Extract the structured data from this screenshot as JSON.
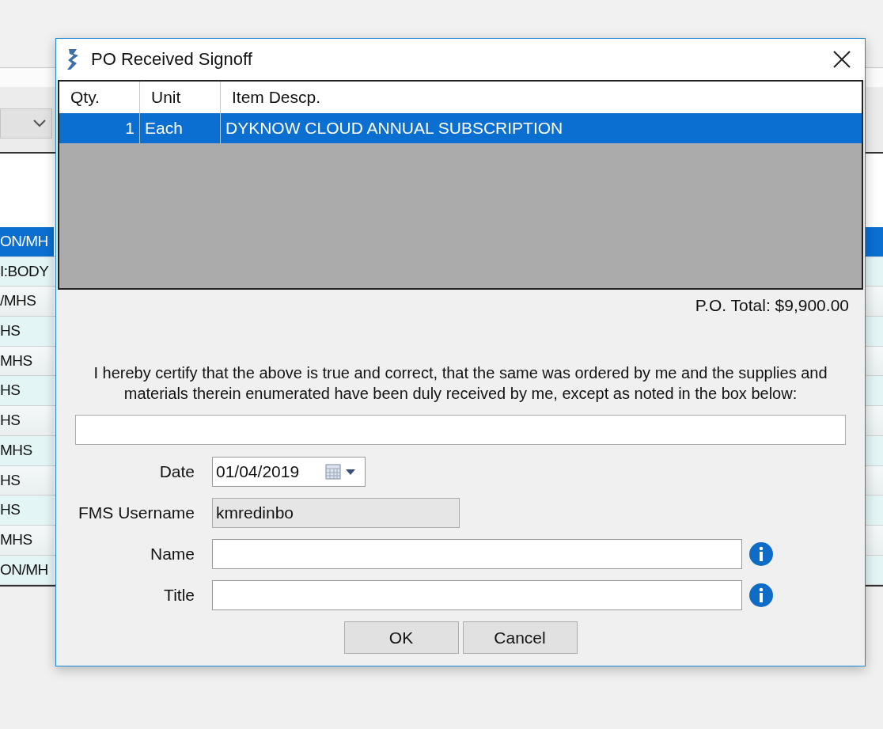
{
  "background": {
    "rows": [
      {
        "text": "ON/MH",
        "selected": true
      },
      {
        "text": "I:BODY",
        "selected": false
      },
      {
        "text": "/MHS",
        "selected": false
      },
      {
        "text": "HS",
        "selected": false
      },
      {
        "text": "MHS",
        "selected": false
      },
      {
        "text": "HS",
        "selected": false
      },
      {
        "text": "HS",
        "selected": false
      },
      {
        "text": "MHS",
        "selected": false
      },
      {
        "text": "HS",
        "selected": false
      },
      {
        "text": "HS",
        "selected": false
      },
      {
        "text": "MHS",
        "selected": false
      },
      {
        "text": "ON/MH",
        "selected": false
      }
    ]
  },
  "dialog": {
    "title": "PO Received Signoff",
    "table": {
      "columns": [
        "Qty.",
        "Unit",
        "Item Descp."
      ],
      "rows": [
        {
          "qty": "1",
          "unit": "Each",
          "description": "DYKNOW CLOUD ANNUAL SUBSCRIPTION",
          "selected": true
        }
      ]
    },
    "po_total": "P.O. Total: $9,900.00",
    "certification": "I hereby certify that the above is true and correct, that the same was ordered by me and the supplies and materials therein enumerated have been duly received by me, except as noted in the box below:",
    "fields": [
      {
        "label": "Date",
        "kind": "date",
        "value": "01/04/2019",
        "info": false
      },
      {
        "label": "FMS Username",
        "kind": "readonly",
        "value": "kmredinbo",
        "info": false
      },
      {
        "label": "Name",
        "kind": "text",
        "info": true
      },
      {
        "label": "Title",
        "kind": "text",
        "info": true
      }
    ],
    "buttons": [
      "OK",
      "Cancel"
    ]
  }
}
